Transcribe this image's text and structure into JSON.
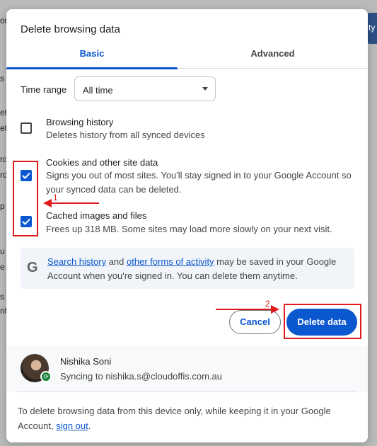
{
  "background": {
    "left_fragments": [
      "or",
      "s",
      "et",
      "et",
      "rd",
      "rd",
      "p",
      "u",
      "e",
      "s",
      "nt"
    ],
    "right_fragment": "ty"
  },
  "dialog": {
    "title": "Delete browsing data",
    "tabs": [
      {
        "label": "Basic",
        "active": true
      },
      {
        "label": "Advanced",
        "active": false
      }
    ],
    "time_range": {
      "label": "Time range",
      "value": "All time"
    },
    "options": [
      {
        "title": "Browsing history",
        "description": "Deletes history from all synced devices",
        "checked": false
      },
      {
        "title": "Cookies and other site data",
        "description": "Signs you out of most sites. You'll stay signed in to your Google Account so your synced data can be deleted.",
        "checked": true
      },
      {
        "title": "Cached images and files",
        "description": "Frees up 318 MB. Some sites may load more slowly on your next visit.",
        "checked": true
      }
    ],
    "info": {
      "icon": "google-g-icon",
      "link1": "Search history",
      "text1": " and ",
      "link2": "other forms of activity",
      "text2": " may be saved in your Google Account when you're signed in. You can delete them anytime."
    },
    "buttons": {
      "cancel": "Cancel",
      "delete": "Delete data"
    },
    "account": {
      "name": "Nishika Soni",
      "sync_text": "Syncing to nishika.s@cloudoffis.com.au"
    },
    "footer": {
      "text": "To delete browsing data from this device only, while keeping it in your Google Account, ",
      "link": "sign out",
      "end": "."
    }
  },
  "annotations": {
    "label1": "1",
    "label2": "2",
    "color": "#e01b1b"
  },
  "colors": {
    "accent": "#0b57d0",
    "annotation": "#e01b1b"
  }
}
